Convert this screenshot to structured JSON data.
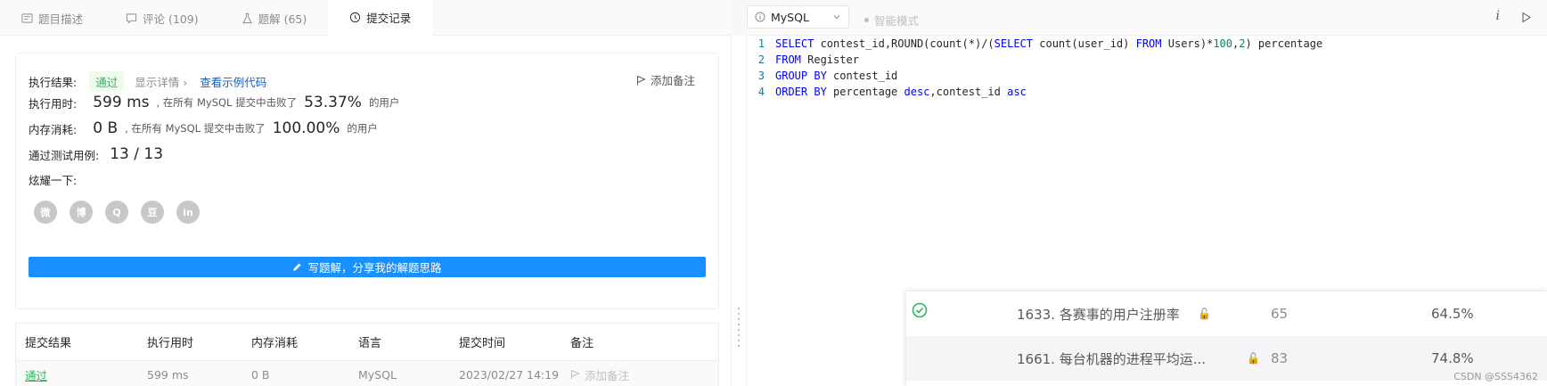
{
  "tabs": [
    {
      "label": "题目描述"
    },
    {
      "label": "评论 (109)"
    },
    {
      "label": "题解 (65)"
    },
    {
      "label": "提交记录"
    }
  ],
  "result": {
    "label_result": "执行结果:",
    "status": "通过",
    "show_details": "显示详情 ›",
    "view_sample": "查看示例代码",
    "add_note": "添加备注",
    "label_time": "执行用时:",
    "time_value": "599 ms",
    "time_beat_text": ", 在所有 MySQL 提交中击败了",
    "time_percent": "53.37%",
    "users_suffix": "的用户",
    "label_memory": "内存消耗:",
    "memory_value": "0 B",
    "memory_beat_text": ", 在所有 MySQL 提交中击败了",
    "memory_percent": "100.00%",
    "label_tests": "通过测试用例:",
    "tests_value": "13 / 13",
    "label_share": "炫耀一下:",
    "write_solution": "写题解，分享我的解题思路"
  },
  "shares": [
    {
      "icon": "wechat-icon",
      "glyph": "微"
    },
    {
      "icon": "weibo-icon",
      "glyph": "博"
    },
    {
      "icon": "qq-icon",
      "glyph": "Q"
    },
    {
      "icon": "douban-icon",
      "glyph": "豆"
    },
    {
      "icon": "linkedin-icon",
      "glyph": "in"
    }
  ],
  "table": {
    "headers": [
      "提交结果",
      "执行用时",
      "内存消耗",
      "语言",
      "提交时间",
      "备注"
    ],
    "rows": [
      {
        "result": "通过",
        "time": "599 ms",
        "memory": "0 B",
        "lang": "MySQL",
        "submitted": "2023/02/27 14:19",
        "note": "添加备注"
      }
    ]
  },
  "editor": {
    "language": "MySQL",
    "ai_mode": "智能模式",
    "lines": [
      "SELECT contest_id,ROUND(count(*)/(SELECT count(user_id) FROM Users)*100,2) percentage",
      "FROM Register",
      "GROUP BY contest_id",
      "ORDER BY percentage desc,contest_id asc"
    ]
  },
  "popup": {
    "rows": [
      {
        "title": "1633. 各赛事的用户注册率",
        "count": "65",
        "rate": "64.5%",
        "solved": true
      },
      {
        "title": "1661. 每台机器的进程平均运...",
        "count": "83",
        "rate": "74.8%",
        "solved": false
      }
    ]
  },
  "watermark": "CSDN @SSS4362",
  "colors": {
    "accent": "#1890ff",
    "pass": "#2db55d",
    "lock": "#f5a623"
  }
}
